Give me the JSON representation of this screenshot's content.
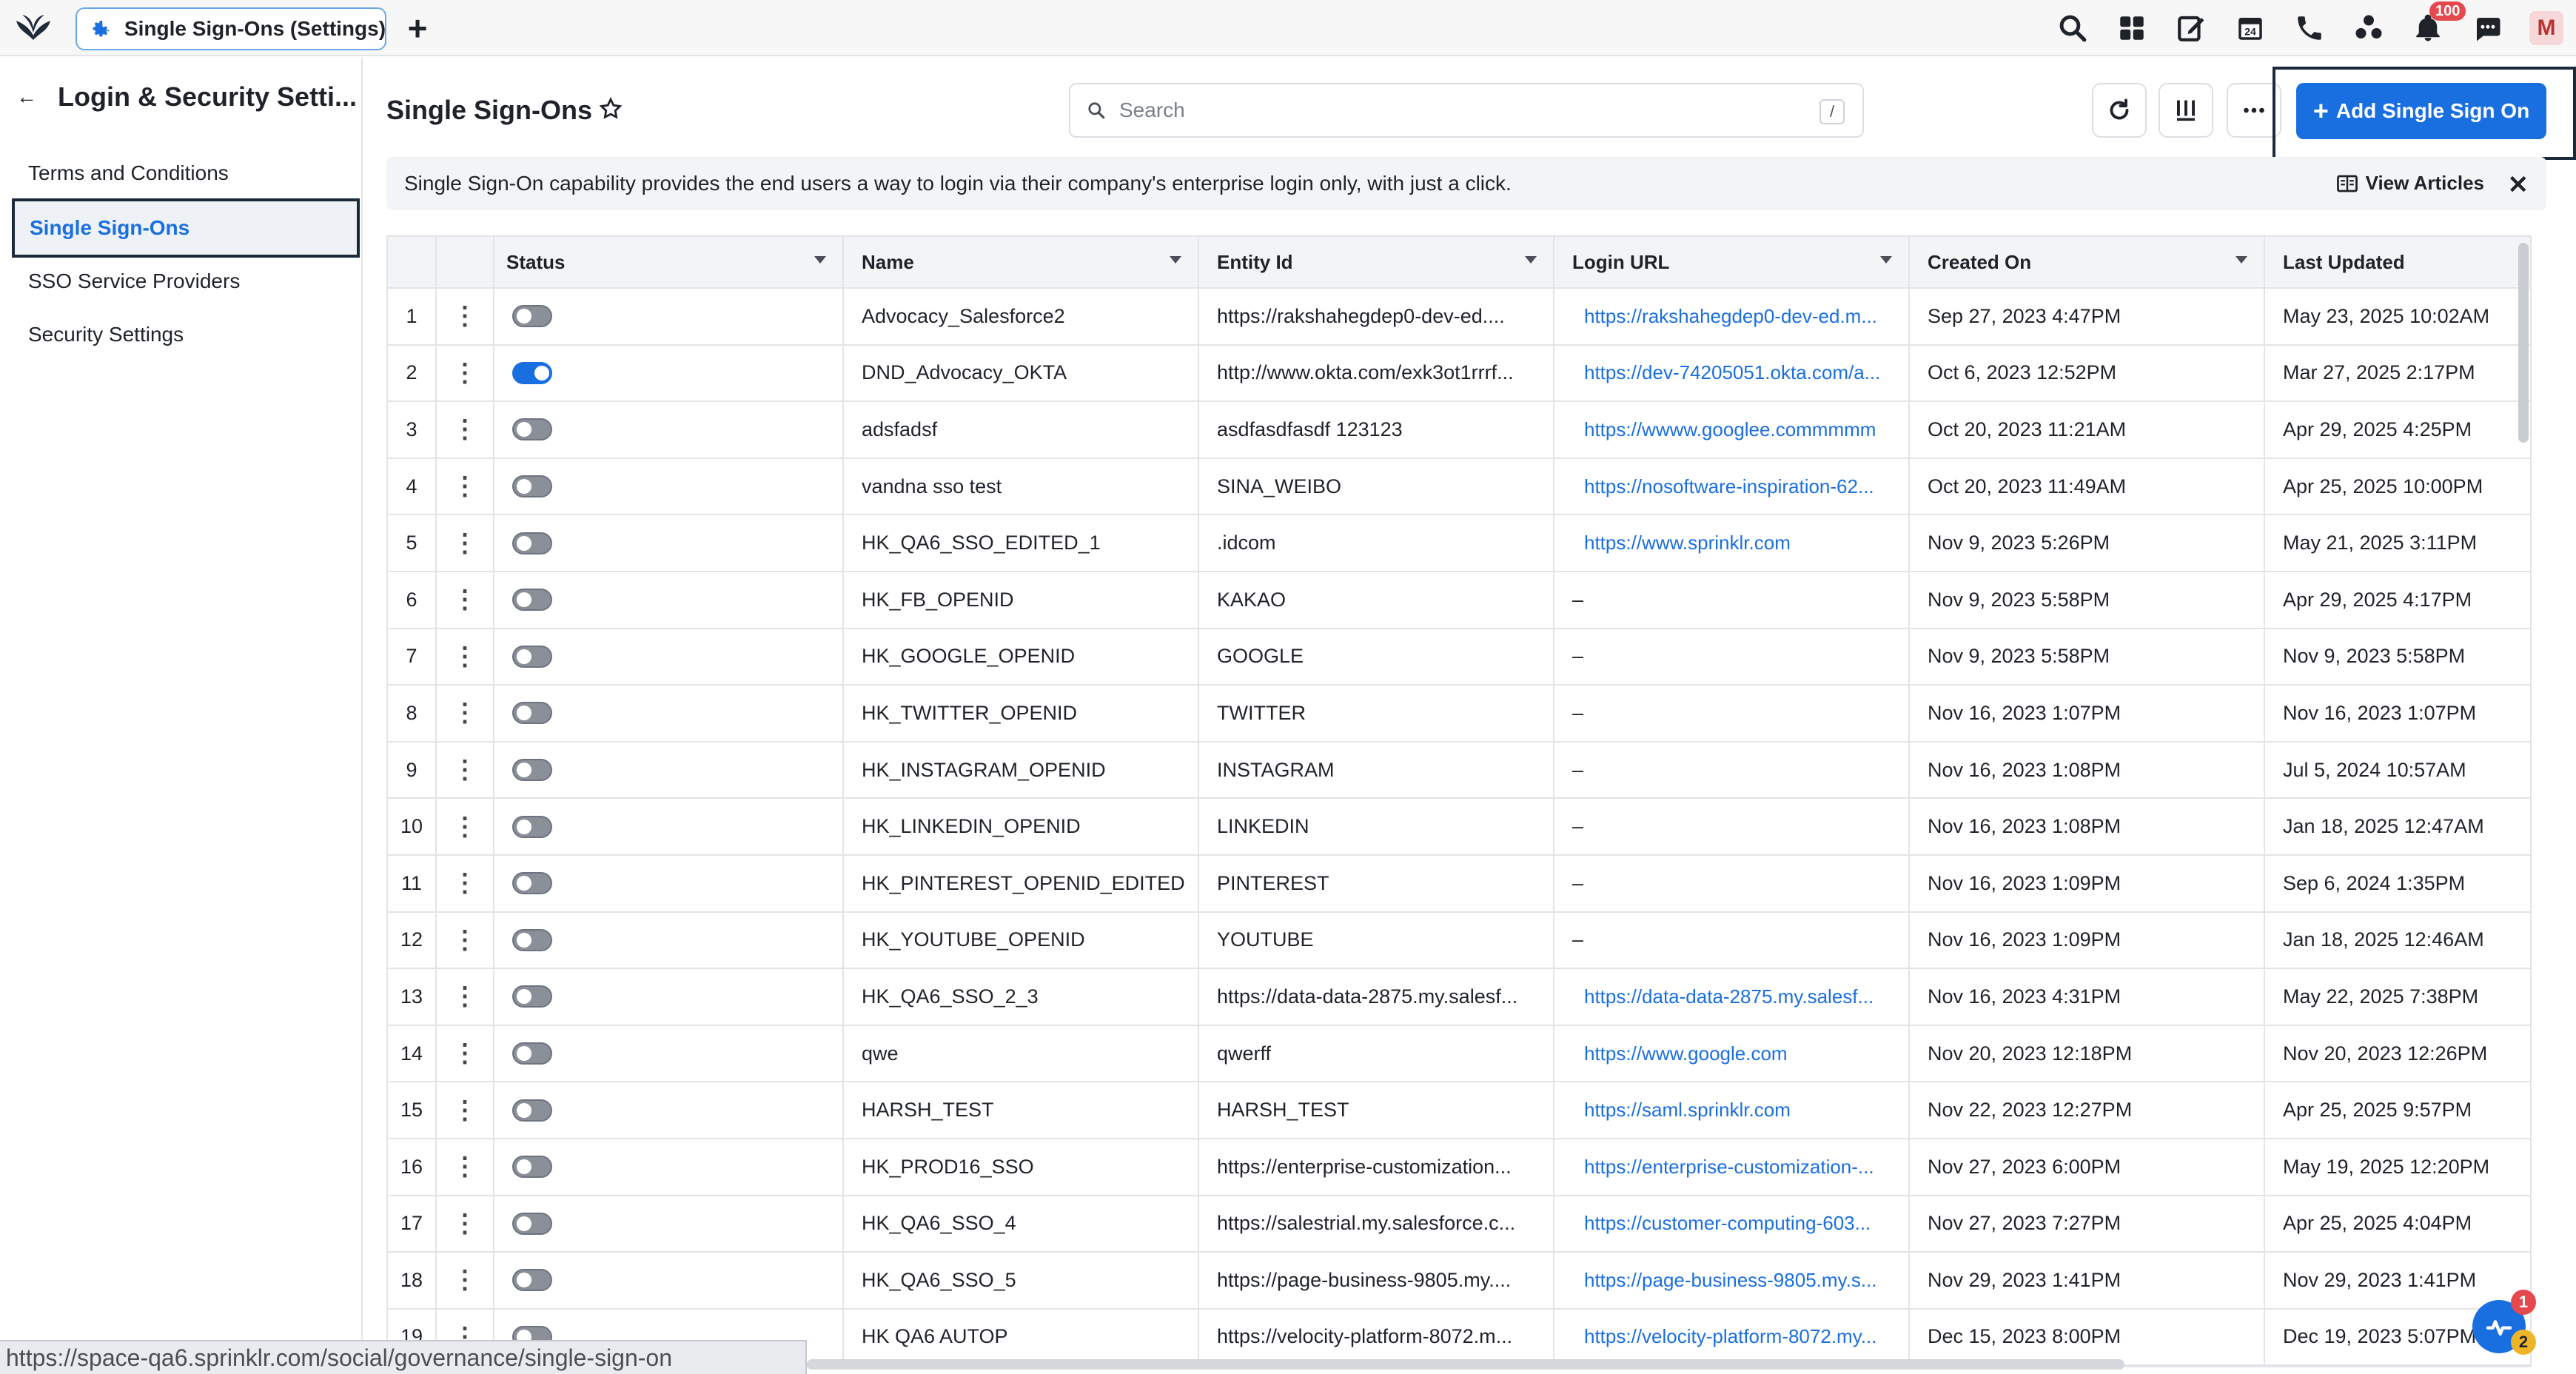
{
  "tab": {
    "label": "Single Sign-Ons (Settings)"
  },
  "topbar": {
    "notification_count": "100",
    "avatar_initial": "M",
    "icons": [
      "search-icon",
      "apps-grid-icon",
      "compose-icon",
      "calendar-icon",
      "phone-icon",
      "network-icon",
      "bell-icon",
      "chat-icon"
    ],
    "calendar_day": "24"
  },
  "sidebar": {
    "title": "Login & Security Setti...",
    "items": [
      {
        "label": "Terms and Conditions"
      },
      {
        "label": "Single Sign-Ons"
      },
      {
        "label": "SSO Service Providers"
      },
      {
        "label": "Security Settings"
      }
    ]
  },
  "main": {
    "title": "Single Sign-Ons",
    "search_placeholder": "Search",
    "search_shortcut": "/",
    "add_button": "Add Single Sign On",
    "banner_text": "Single Sign-On capability provides the end users a way to login via their company's enterprise login only, with just a click.",
    "view_articles": "View Articles"
  },
  "table": {
    "columns": [
      "Status",
      "Name",
      "Entity Id",
      "Login URL",
      "Created On",
      "Last Updated"
    ],
    "rows": [
      {
        "num": "1",
        "on": false,
        "name": "Advocacy_Salesforce2",
        "entity": "https://rakshahegdep0-dev-ed....",
        "url": "https://rakshahegdep0-dev-ed.m...",
        "created": "Sep 27, 2023 4:47PM",
        "updated": "May 23, 2025 10:02AM"
      },
      {
        "num": "2",
        "on": true,
        "name": "DND_Advocacy_OKTA",
        "entity": "http://www.okta.com/exk3ot1rrrf...",
        "url": "https://dev-74205051.okta.com/a...",
        "created": "Oct 6, 2023 12:52PM",
        "updated": "Mar 27, 2025 2:17PM"
      },
      {
        "num": "3",
        "on": false,
        "name": "adsfadsf",
        "entity": "asdfasdfasdf 123123",
        "url": "https://wwww.googlee.commmmm",
        "created": "Oct 20, 2023 11:21AM",
        "updated": "Apr 29, 2025 4:25PM"
      },
      {
        "num": "4",
        "on": false,
        "name": "vandna sso test",
        "entity": "SINA_WEIBO",
        "url": "https://nosoftware-inspiration-62...",
        "created": "Oct 20, 2023 11:49AM",
        "updated": "Apr 25, 2025 10:00PM"
      },
      {
        "num": "5",
        "on": false,
        "name": "HK_QA6_SSO_EDITED_1",
        "entity": ".idcom",
        "url": "https://www.sprinklr.com",
        "created": "Nov 9, 2023 5:26PM",
        "updated": "May 21, 2025 3:11PM"
      },
      {
        "num": "6",
        "on": false,
        "name": "HK_FB_OPENID",
        "entity": "KAKAO",
        "url": "–",
        "created": "Nov 9, 2023 5:58PM",
        "updated": "Apr 29, 2025 4:17PM"
      },
      {
        "num": "7",
        "on": false,
        "name": "HK_GOOGLE_OPENID",
        "entity": "GOOGLE",
        "url": "–",
        "created": "Nov 9, 2023 5:58PM",
        "updated": "Nov 9, 2023 5:58PM"
      },
      {
        "num": "8",
        "on": false,
        "name": "HK_TWITTER_OPENID",
        "entity": "TWITTER",
        "url": "–",
        "created": "Nov 16, 2023 1:07PM",
        "updated": "Nov 16, 2023 1:07PM"
      },
      {
        "num": "9",
        "on": false,
        "name": "HK_INSTAGRAM_OPENID",
        "entity": "INSTAGRAM",
        "url": "–",
        "created": "Nov 16, 2023 1:08PM",
        "updated": "Jul 5, 2024 10:57AM"
      },
      {
        "num": "10",
        "on": false,
        "name": "HK_LINKEDIN_OPENID",
        "entity": "LINKEDIN",
        "url": "–",
        "created": "Nov 16, 2023 1:08PM",
        "updated": "Jan 18, 2025 12:47AM"
      },
      {
        "num": "11",
        "on": false,
        "name": "HK_PINTEREST_OPENID_EDITED",
        "entity": "PINTEREST",
        "url": "–",
        "created": "Nov 16, 2023 1:09PM",
        "updated": "Sep 6, 2024 1:35PM"
      },
      {
        "num": "12",
        "on": false,
        "name": "HK_YOUTUBE_OPENID",
        "entity": "YOUTUBE",
        "url": "–",
        "created": "Nov 16, 2023 1:09PM",
        "updated": "Jan 18, 2025 12:46AM"
      },
      {
        "num": "13",
        "on": false,
        "name": "HK_QA6_SSO_2_3",
        "entity": "https://data-data-2875.my.salesf...",
        "url": "https://data-data-2875.my.salesf...",
        "created": "Nov 16, 2023 4:31PM",
        "updated": "May 22, 2025 7:38PM"
      },
      {
        "num": "14",
        "on": false,
        "name": "qwe",
        "entity": "qwerff",
        "url": "https://www.google.com",
        "created": "Nov 20, 2023 12:18PM",
        "updated": "Nov 20, 2023 12:26PM"
      },
      {
        "num": "15",
        "on": false,
        "name": "HARSH_TEST",
        "entity": "HARSH_TEST",
        "url": "https://saml.sprinklr.com",
        "created": "Nov 22, 2023 12:27PM",
        "updated": "Apr 25, 2025 9:57PM"
      },
      {
        "num": "16",
        "on": false,
        "name": "HK_PROD16_SSO",
        "entity": "https://enterprise-customization...",
        "url": "https://enterprise-customization-...",
        "created": "Nov 27, 2023 6:00PM",
        "updated": "May 19, 2025 12:20PM"
      },
      {
        "num": "17",
        "on": false,
        "name": "HK_QA6_SSO_4",
        "entity": "https://salestrial.my.salesforce.c...",
        "url": "https://customer-computing-603...",
        "created": "Nov 27, 2023 7:27PM",
        "updated": "Apr 25, 2025 4:04PM"
      },
      {
        "num": "18",
        "on": false,
        "name": "HK_QA6_SSO_5",
        "entity": "https://page-business-9805.my....",
        "url": "https://page-business-9805.my.s...",
        "created": "Nov 29, 2023 1:41PM",
        "updated": "Nov 29, 2023 1:41PM"
      },
      {
        "num": "19",
        "on": false,
        "name": "HK QA6 AUTOP",
        "entity": "https://velocity-platform-8072.m...",
        "url": "https://velocity-platform-8072.my...",
        "created": "Dec 15, 2023 8:00PM",
        "updated": "Dec 19, 2023 5:07PM"
      }
    ]
  },
  "statusbar": {
    "url": "https://space-qa6.sprinklr.com/social/governance/single-sign-on"
  },
  "fab": {
    "badge_top": "1",
    "badge_bottom": "2"
  },
  "colors": {
    "accent": "#1a6fe0",
    "badge": "#e5484d",
    "selection_border": "#1b2a3a"
  }
}
